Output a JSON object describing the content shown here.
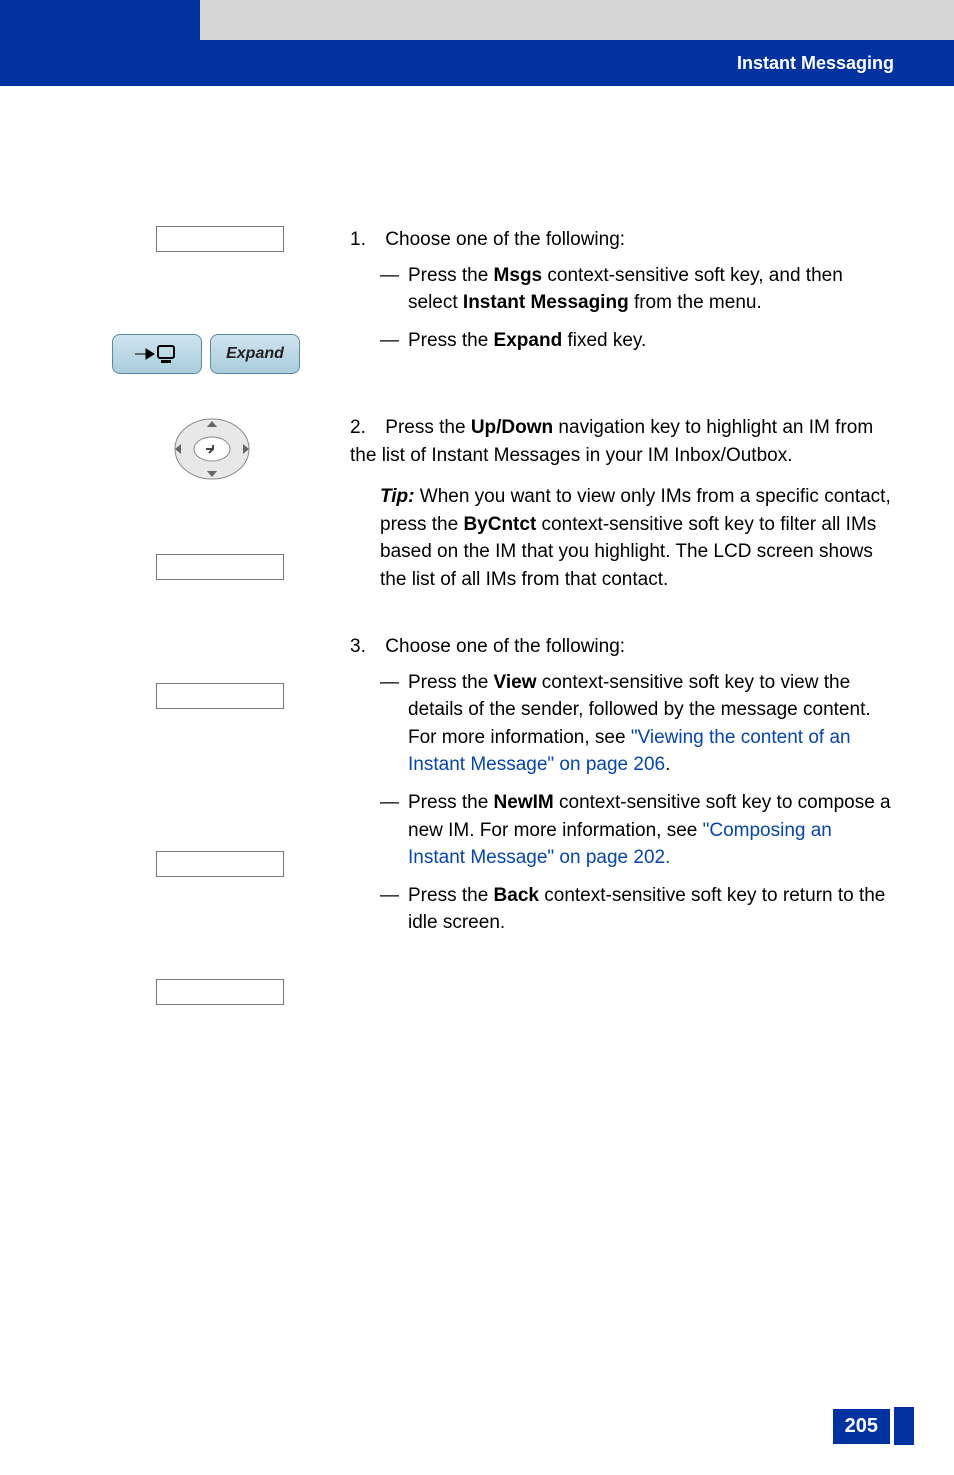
{
  "header": {
    "section_title": "Instant Messaging"
  },
  "icons": {
    "expand_label": "Expand"
  },
  "steps": {
    "s1": {
      "num": "1.",
      "lead": "Choose one of the following:",
      "a": {
        "pre": "— ",
        "t1": "Press the ",
        "key1": "Msgs",
        "t2": " context-sensitive soft key, and then select ",
        "key2": "Instant Messaging",
        "t3": " from the menu."
      },
      "b": {
        "pre": "— ",
        "t1": "Press the ",
        "key1": "Expand",
        "t2": " fixed key."
      }
    },
    "s2": {
      "num": "2.",
      "p1a": "Press the ",
      "p1key": "Up/Down",
      "p1b": " navigation key to highlight an IM from the list of Instant Messages in your IM Inbox/Outbox.",
      "tip_label": "Tip:",
      "tip_a": " When you want to view only IMs from a specific contact, press the ",
      "tip_key": "ByCntct",
      "tip_b": " context-sensitive soft key to filter all IMs based on the IM that you highlight. The LCD screen shows the list of all IMs from that contact."
    },
    "s3": {
      "num": "3.",
      "lead": "Choose one of the following:",
      "a": {
        "t1": "Press the ",
        "key": "View",
        "t2": " context-sensitive soft key to view the details of the sender, followed by the message content. For more information, see ",
        "link": "\"Viewing the content of an Instant Message\" on page 206",
        "tail": "."
      },
      "b": {
        "t1": "Press the ",
        "key": "NewIM",
        "t2": " context-sensitive soft key to compose a new IM. For more information, see ",
        "link": "\"Composing an Instant Message\" on page 202.",
        "tail": ""
      },
      "c": {
        "t1": "Press the ",
        "key": "Back",
        "t2": " context-sensitive soft key to return to the idle screen."
      }
    }
  },
  "footer": {
    "page_number": "205"
  }
}
